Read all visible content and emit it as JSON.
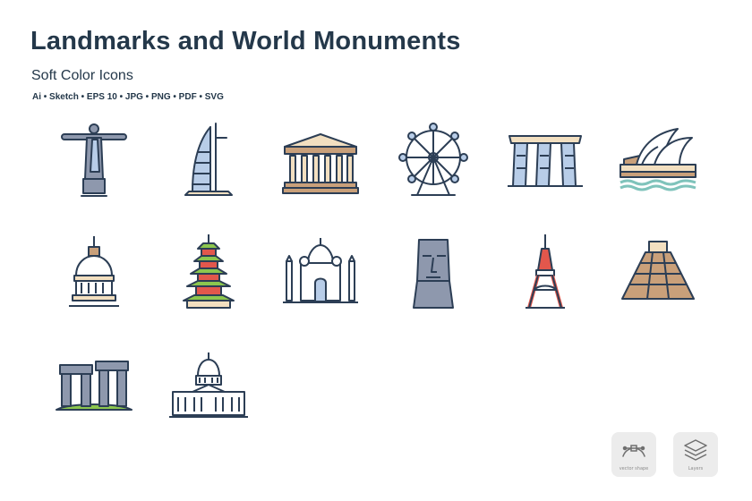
{
  "header": {
    "title": "Landmarks and World Monuments",
    "subtitle": "Soft Color Icons",
    "formats": "Ai • Sketch • EPS 10 • JPG • PNG • PDF • SVG"
  },
  "icons": [
    {
      "name": "christ-the-redeemer-icon"
    },
    {
      "name": "burj-al-arab-icon"
    },
    {
      "name": "parthenon-icon"
    },
    {
      "name": "ferris-wheel-icon"
    },
    {
      "name": "marina-bay-sands-icon"
    },
    {
      "name": "sydney-opera-house-icon"
    },
    {
      "name": "dome-tower-icon"
    },
    {
      "name": "pagoda-icon"
    },
    {
      "name": "taj-mahal-icon"
    },
    {
      "name": "moai-icon"
    },
    {
      "name": "tokyo-tower-icon"
    },
    {
      "name": "chichen-itza-pyramid-icon"
    },
    {
      "name": "stonehenge-icon"
    },
    {
      "name": "capitol-building-icon"
    }
  ],
  "badges": {
    "vector": {
      "label": "vector shape",
      "icon": "bezier-curve-icon"
    },
    "layers": {
      "label": "Layers",
      "icon": "layers-icon"
    }
  },
  "colors": {
    "outline": "#2c3e55",
    "blue": "#b8cde8",
    "gray": "#8e98ad",
    "beige": "#f2dfc0",
    "tan": "#c9a07a",
    "red": "#e2574c",
    "green": "#8cc64e",
    "teal": "#7fc3bb"
  }
}
